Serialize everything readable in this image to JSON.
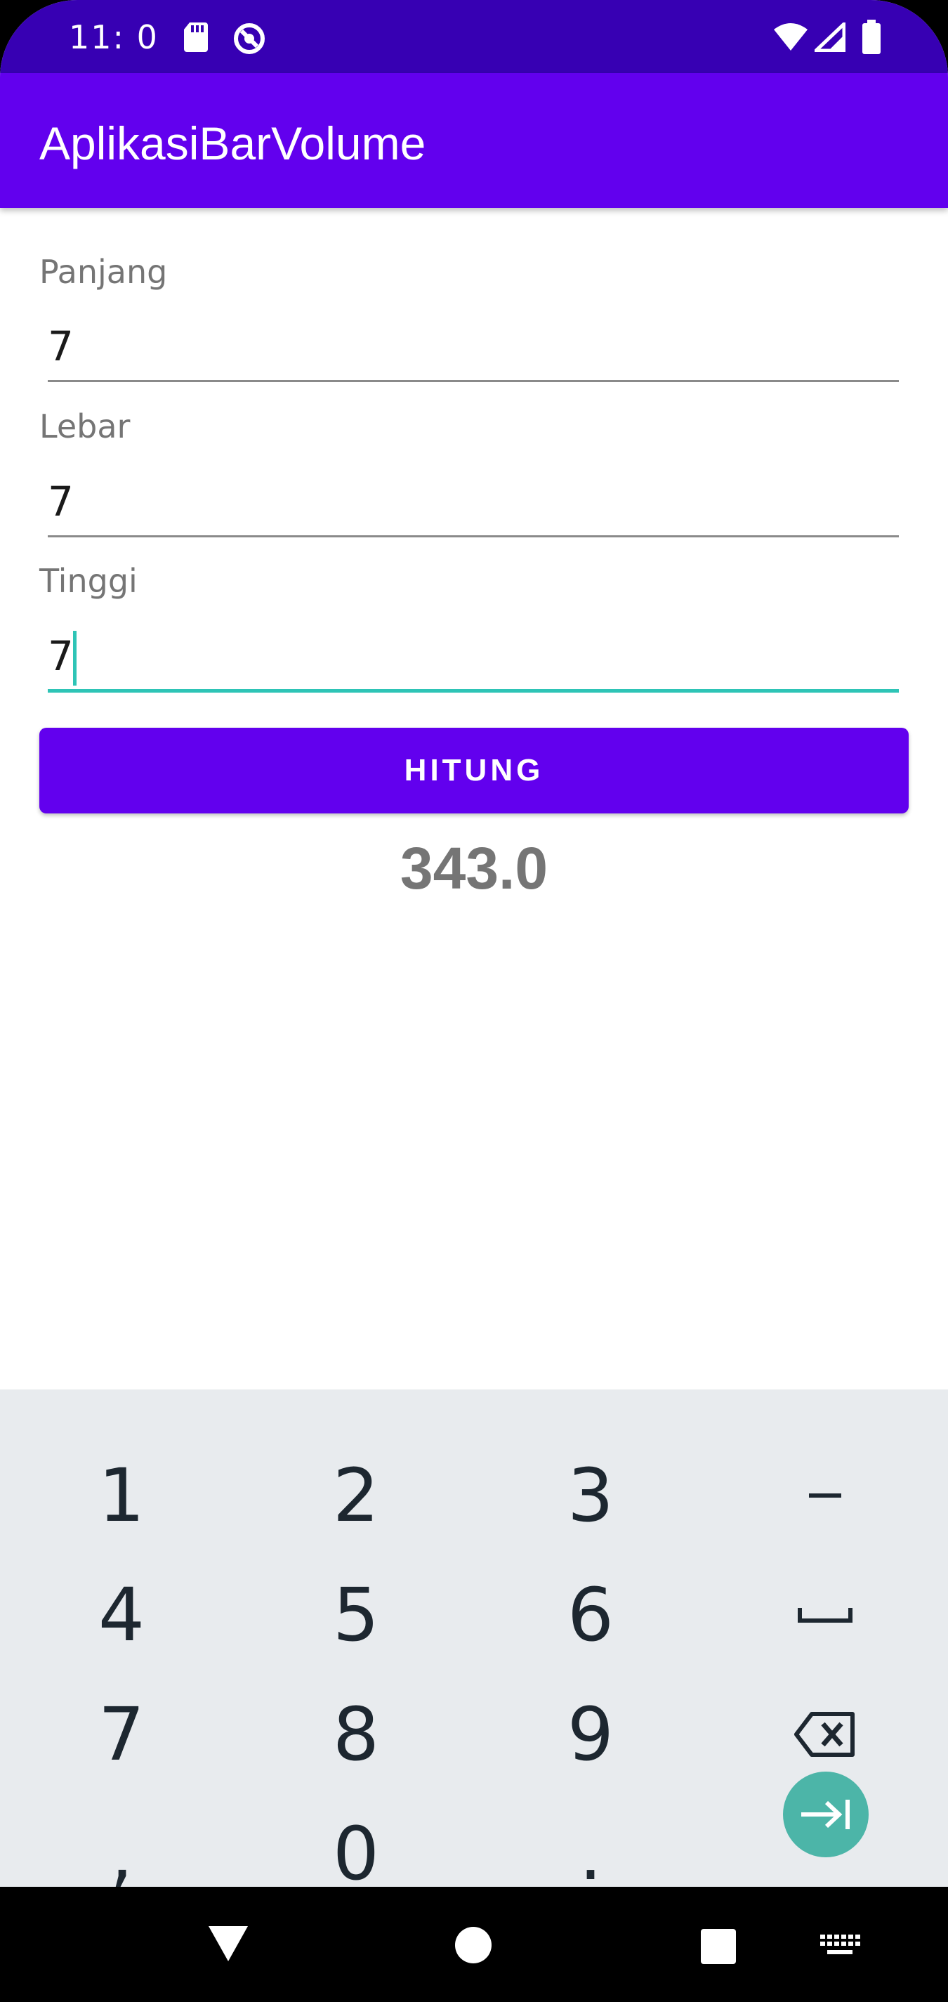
{
  "status_bar": {
    "time": "11: 0",
    "icons": [
      "sd-card-icon",
      "sync-icon",
      "wifi-icon",
      "signal-icon",
      "battery-icon"
    ]
  },
  "app_bar": {
    "title": "AplikasiBarVolume"
  },
  "form": {
    "panjang": {
      "label": "Panjang",
      "value": "7"
    },
    "lebar": {
      "label": "Lebar",
      "value": "7"
    },
    "tinggi": {
      "label": "Tinggi",
      "value": "7"
    }
  },
  "button": {
    "label": "HITUNG"
  },
  "result": {
    "value": "343.0"
  },
  "keyboard": {
    "rows": [
      [
        "1",
        "2",
        "3",
        "-"
      ],
      [
        "4",
        "5",
        "6",
        "space-icon"
      ],
      [
        "7",
        "8",
        "9",
        "backspace-icon"
      ],
      [
        ",",
        "0",
        ".",
        "tab-next-icon"
      ]
    ]
  },
  "colors": {
    "status_bar": "#3700b3",
    "primary": "#6200ee",
    "accent": "#2ec4b6",
    "keyboard_bg": "#e8ebee",
    "enter_key": "#4cb5a8"
  },
  "nav_bar": {
    "icons": [
      "back-icon",
      "home-icon",
      "recents-icon",
      "keyboard-switch-icon"
    ]
  }
}
